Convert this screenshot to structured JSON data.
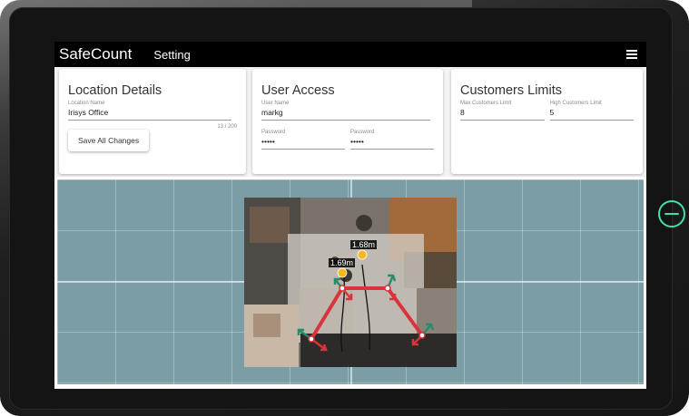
{
  "app": {
    "brand": "SafeCount",
    "nav_link": "Setting",
    "menu_icon": "hamburger-menu-icon"
  },
  "location": {
    "title": "Location Details",
    "name_label": "Location Name",
    "name_value": "Irisys Office",
    "char_count": "13 / 200",
    "save_label": "Save All Changes"
  },
  "user_access": {
    "title": "User Access",
    "username_label": "User Name",
    "username_value": "markg",
    "password_label": "Password",
    "password_value": "•••••",
    "confirm_label": "Password",
    "confirm_value": "•••••"
  },
  "limits": {
    "title": "Customers Limits",
    "max_label": "Max Customers Limit",
    "max_value": "8",
    "high_label": "High Customers Limit",
    "high_value": "5"
  },
  "camera": {
    "person_a_height": "1.68m",
    "person_b_height": "1.69m",
    "accent_line": "#d9333b",
    "accent_arrow": "#2a8a6a",
    "marker": "#f5b820"
  },
  "device": {
    "home_icon": "power-button-icon",
    "accent": "#3fe0b0"
  }
}
